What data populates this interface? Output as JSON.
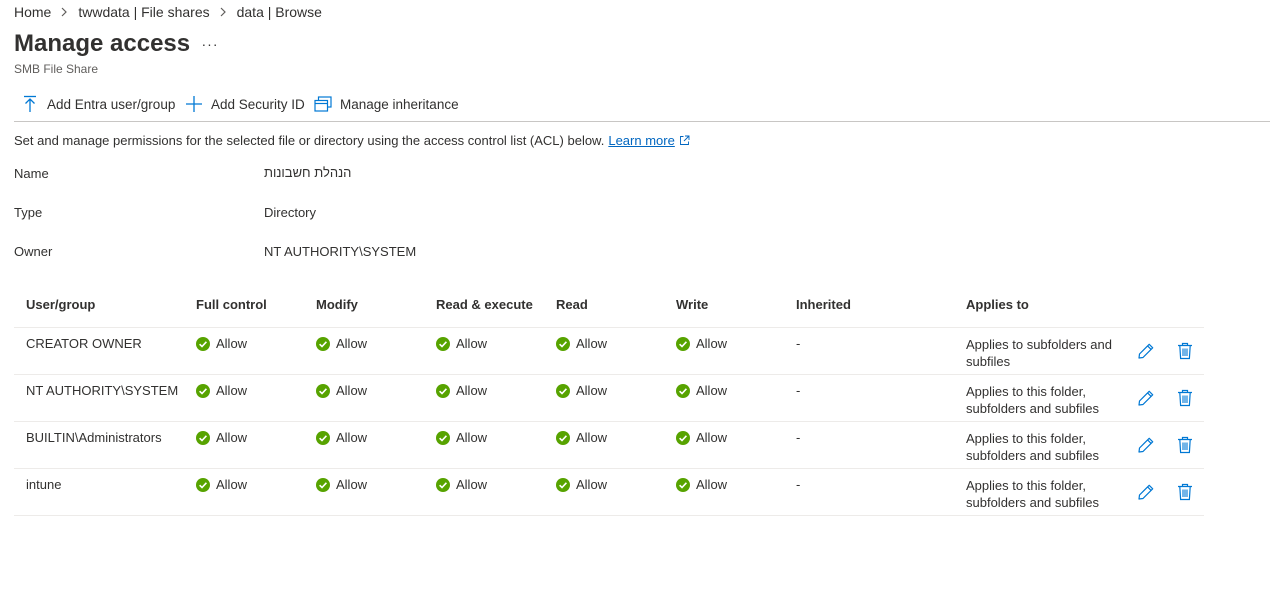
{
  "breadcrumb": {
    "items": [
      "Home",
      "twwdata | File shares",
      "data | Browse"
    ]
  },
  "page": {
    "title": "Manage access",
    "more": "···",
    "subtitle": "SMB File Share"
  },
  "toolbar": {
    "add_entra": "Add Entra user/group",
    "add_sid": "Add Security ID",
    "manage_inheritance": "Manage inheritance"
  },
  "description": {
    "text": "Set and manage permissions for the selected file or directory using the access control list (ACL) below.",
    "link": "Learn more"
  },
  "properties": {
    "name_label": "Name",
    "name_value": "הנהלת חשבונות",
    "type_label": "Type",
    "type_value": "Directory",
    "owner_label": "Owner",
    "owner_value": "NT AUTHORITY\\SYSTEM"
  },
  "table": {
    "headers": [
      "User/group",
      "Full control",
      "Modify",
      "Read & execute",
      "Read",
      "Write",
      "Inherited",
      "Applies to"
    ],
    "rows": [
      {
        "user": "CREATOR OWNER",
        "full": "Allow",
        "modify": "Allow",
        "read_execute": "Allow",
        "read": "Allow",
        "write": "Allow",
        "inherited": "-",
        "applies": "Applies to subfolders and subfiles"
      },
      {
        "user": "NT AUTHORITY\\SYSTEM",
        "full": "Allow",
        "modify": "Allow",
        "read_execute": "Allow",
        "read": "Allow",
        "write": "Allow",
        "inherited": "-",
        "applies": "Applies to this folder, subfolders and subfiles"
      },
      {
        "user": "BUILTIN\\Administrators",
        "full": "Allow",
        "modify": "Allow",
        "read_execute": "Allow",
        "read": "Allow",
        "write": "Allow",
        "inherited": "-",
        "applies": "Applies to this folder, subfolders and subfiles"
      },
      {
        "user": "intune",
        "full": "Allow",
        "modify": "Allow",
        "read_execute": "Allow",
        "read": "Allow",
        "write": "Allow",
        "inherited": "-",
        "applies": "Applies to this folder, subfolders and subfiles"
      }
    ]
  },
  "icons": {
    "breadcrumb_separator": "chevron-right-icon",
    "add_entra": "upload-arrow-icon",
    "add_sid": "plus-icon",
    "manage_inheritance": "windows-stack-icon",
    "link_external": "external-link-icon",
    "permission_allow": "check-circle-icon",
    "edit": "pencil-icon",
    "delete": "trash-icon"
  },
  "colors": {
    "accent": "#0078d4",
    "link": "#0066c0",
    "allow_green": "#57a300",
    "text": "#323130",
    "divider": "#edebe9"
  }
}
